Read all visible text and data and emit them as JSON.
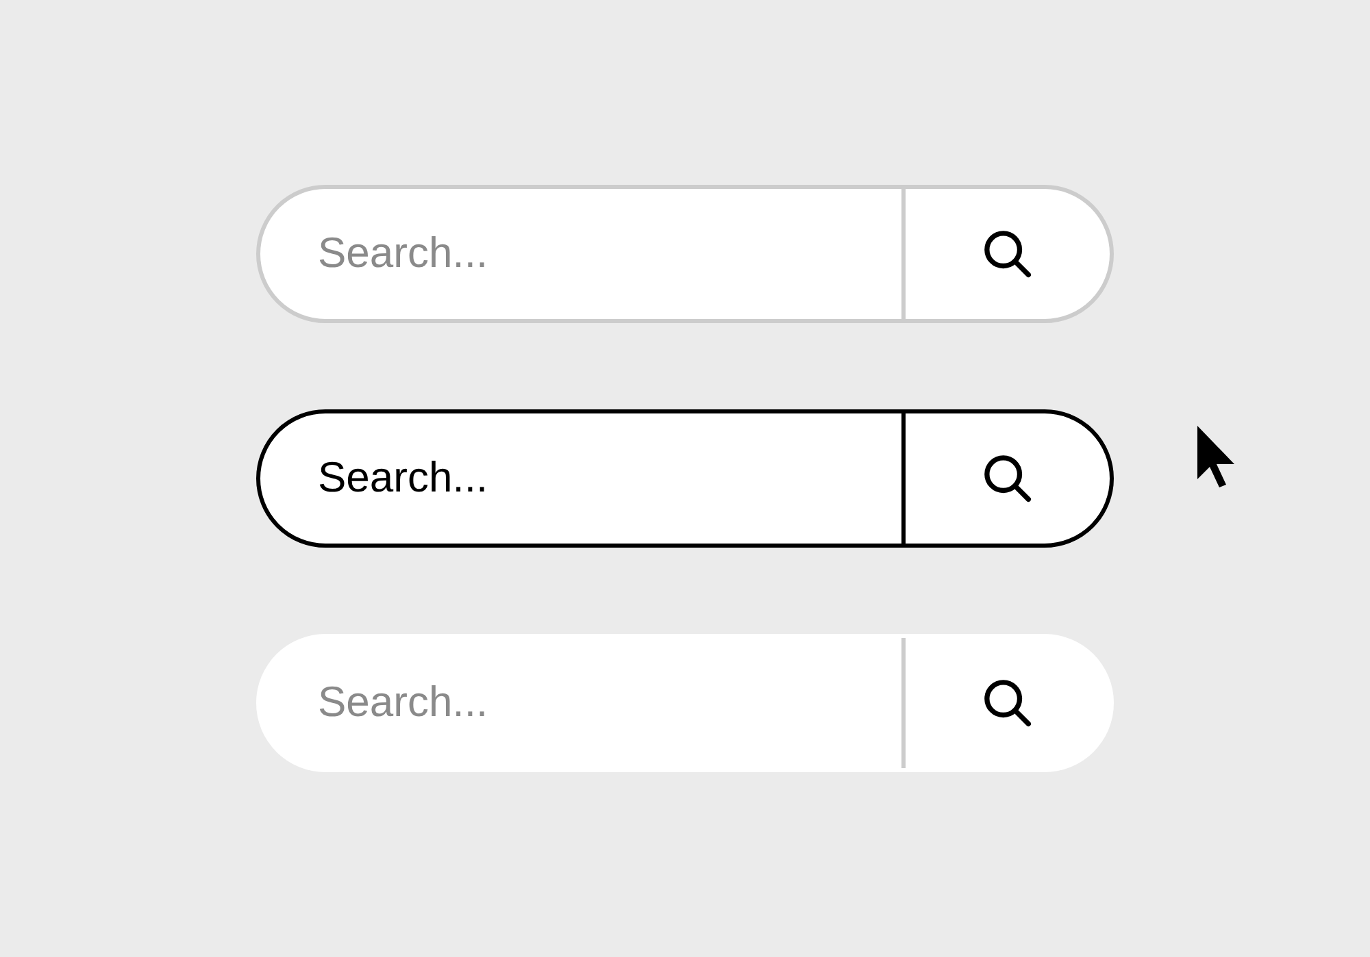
{
  "search_bars": [
    {
      "kind": "outlined",
      "placeholder": "Search..."
    },
    {
      "kind": "active",
      "value": "Search..."
    },
    {
      "kind": "plain",
      "placeholder": "Search..."
    }
  ]
}
